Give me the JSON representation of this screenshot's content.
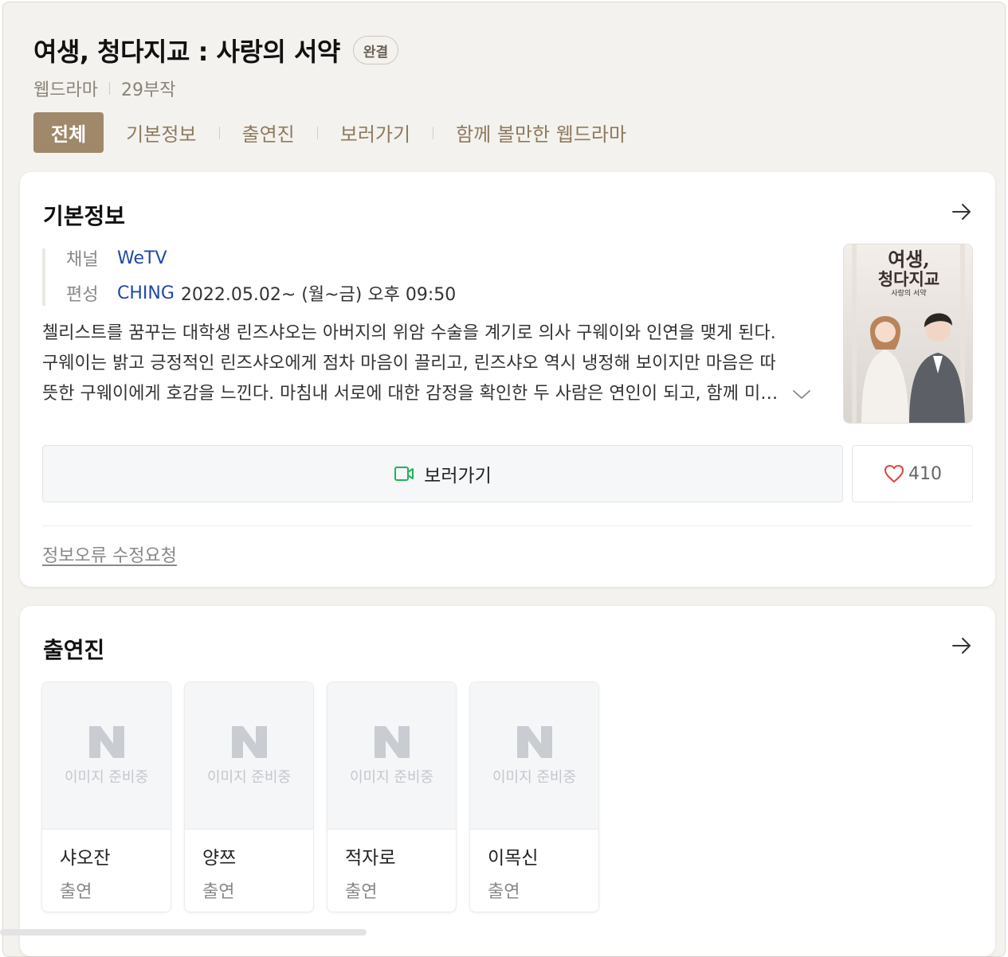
{
  "header": {
    "title": "여생, 청다지교 : 사랑의 서약",
    "status_badge": "완결",
    "genre": "웹드라마",
    "episodes": "29부작"
  },
  "tabs": [
    {
      "label": "전체",
      "active": true
    },
    {
      "label": "기본정보",
      "active": false
    },
    {
      "label": "출연진",
      "active": false
    },
    {
      "label": "보러가기",
      "active": false
    },
    {
      "label": "함께 볼만한 웹드라마",
      "active": false
    }
  ],
  "basic_info": {
    "section_title": "기본정보",
    "channel_label": "채널",
    "channel_value": "WeTV",
    "schedule_label": "편성",
    "schedule_channel": "CHING",
    "schedule_time": "2022.05.02~ (월~금) 오후 09:50",
    "synopsis": "첼리스트를 꿈꾸는 대학생 린즈샤오는 아버지의 위암 수술을 계기로 의사 구웨이와 인연을 맺게 된다. 구웨이는 밝고 긍정적인 린즈샤오에게 점차 마음이 끌리고, 린즈샤오 역시 냉정해 보이지만 마음은 따뜻한 구웨이에게 호감을 느낀다. 마침내 서로에 대한 감정을 확인한 두 사람은 연인이 되고, 함께 미래를 꿈꾼다.",
    "poster_title_line1": "여생,",
    "poster_title_line2": "청다지교",
    "poster_subtitle": "사랑의 서약",
    "watch_button": "보러가기",
    "like_count": "410",
    "report_link": "정보오류 수정요청"
  },
  "cast": {
    "section_title": "출연진",
    "placeholder_logo": "N",
    "placeholder_text": "이미지 준비중",
    "members": [
      {
        "name": "샤오잔",
        "role": "출연"
      },
      {
        "name": "양쯔",
        "role": "출연"
      },
      {
        "name": "적자로",
        "role": "출연"
      },
      {
        "name": "이목신",
        "role": "출연"
      }
    ]
  }
}
